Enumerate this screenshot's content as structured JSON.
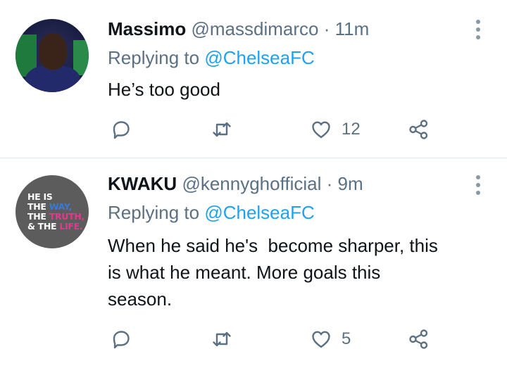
{
  "tweets": [
    {
      "name": "Massimo",
      "handle": "@massdimarco",
      "separator": "·",
      "time": "11m",
      "replying_label": "Replying to",
      "replying_to": "@ChelseaFC",
      "text": "He’s too good",
      "like_count": "12",
      "icons": [
        "reply-icon",
        "retweet-icon",
        "like-icon",
        "share-icon",
        "more-icon"
      ]
    },
    {
      "name": "KWAKU",
      "handle": "@kennyghofficial",
      "separator": "·",
      "time": "9m",
      "replying_label": "Replying to",
      "replying_to": "@ChelseaFC",
      "text_lines": [
        "When he said he's  become sharper, this",
        "is what he meant. More goals this",
        "season."
      ],
      "like_count": "5",
      "avatar_text": {
        "line1": "HE IS",
        "line2a": "THE ",
        "line2b": "WAY,",
        "line3a": "THE ",
        "line3b": "TRUTH,",
        "line4a": "& THE ",
        "line4b": "LIFE."
      },
      "icons": [
        "reply-icon",
        "retweet-icon",
        "like-icon",
        "share-icon",
        "more-icon"
      ]
    }
  ],
  "colors": {
    "mention": "#1da1f2",
    "secondary": "#5b7083",
    "text": "#0f1419",
    "icon": "#5b7083",
    "divider": "#e1e8ed"
  }
}
